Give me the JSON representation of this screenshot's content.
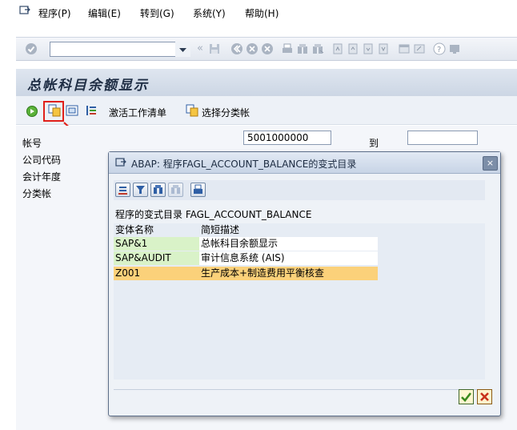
{
  "menu": {
    "items": [
      "程序(P)",
      "编辑(E)",
      "转到(G)",
      "系统(Y)",
      "帮助(H)"
    ]
  },
  "toolbar": {
    "command_field": "",
    "icons": [
      "enter-icon",
      "save-icon",
      "back-icon",
      "exit-icon",
      "cancel-icon",
      "print-icon",
      "find-icon",
      "find-next-icon",
      "first-page-icon",
      "previous-page-icon",
      "next-page-icon",
      "last-page-icon",
      "new-session-icon",
      "shortcut-icon",
      "help-icon",
      "layout-icon"
    ]
  },
  "screen": {
    "title": "总帐科目余额显示"
  },
  "app_toolbar": {
    "activate_worklist": "激活工作清单",
    "select_ledger": "选择分类帐"
  },
  "selection": {
    "account_label": "帐号",
    "account_from": "5001000000",
    "to_label": "到",
    "account_to": "",
    "company_code_label": "公司代码",
    "fiscal_year_label": "会计年度",
    "ledger_label": "分类帐"
  },
  "dialog": {
    "title": "ABAP: 程序FAGL_ACCOUNT_BALANCE的变式目录",
    "subtitle": "程序的变式目录 FAGL_ACCOUNT_BALANCE",
    "columns": [
      "变体名称",
      "简短描述"
    ],
    "rows": [
      {
        "name": "SAP&1",
        "desc": "总帐科目余额显示"
      },
      {
        "name": "SAP&AUDIT",
        "desc": "审计信息系统 (AIS)"
      },
      {
        "name": "Z001",
        "desc": "生产成本+制造费用平衡核查"
      }
    ],
    "close": "×"
  },
  "colors": {
    "annotation": "#e0201a",
    "row_green": "#d9f2c8",
    "row_selected": "#fbd17a",
    "row_selected_border": "#d64a1c"
  }
}
